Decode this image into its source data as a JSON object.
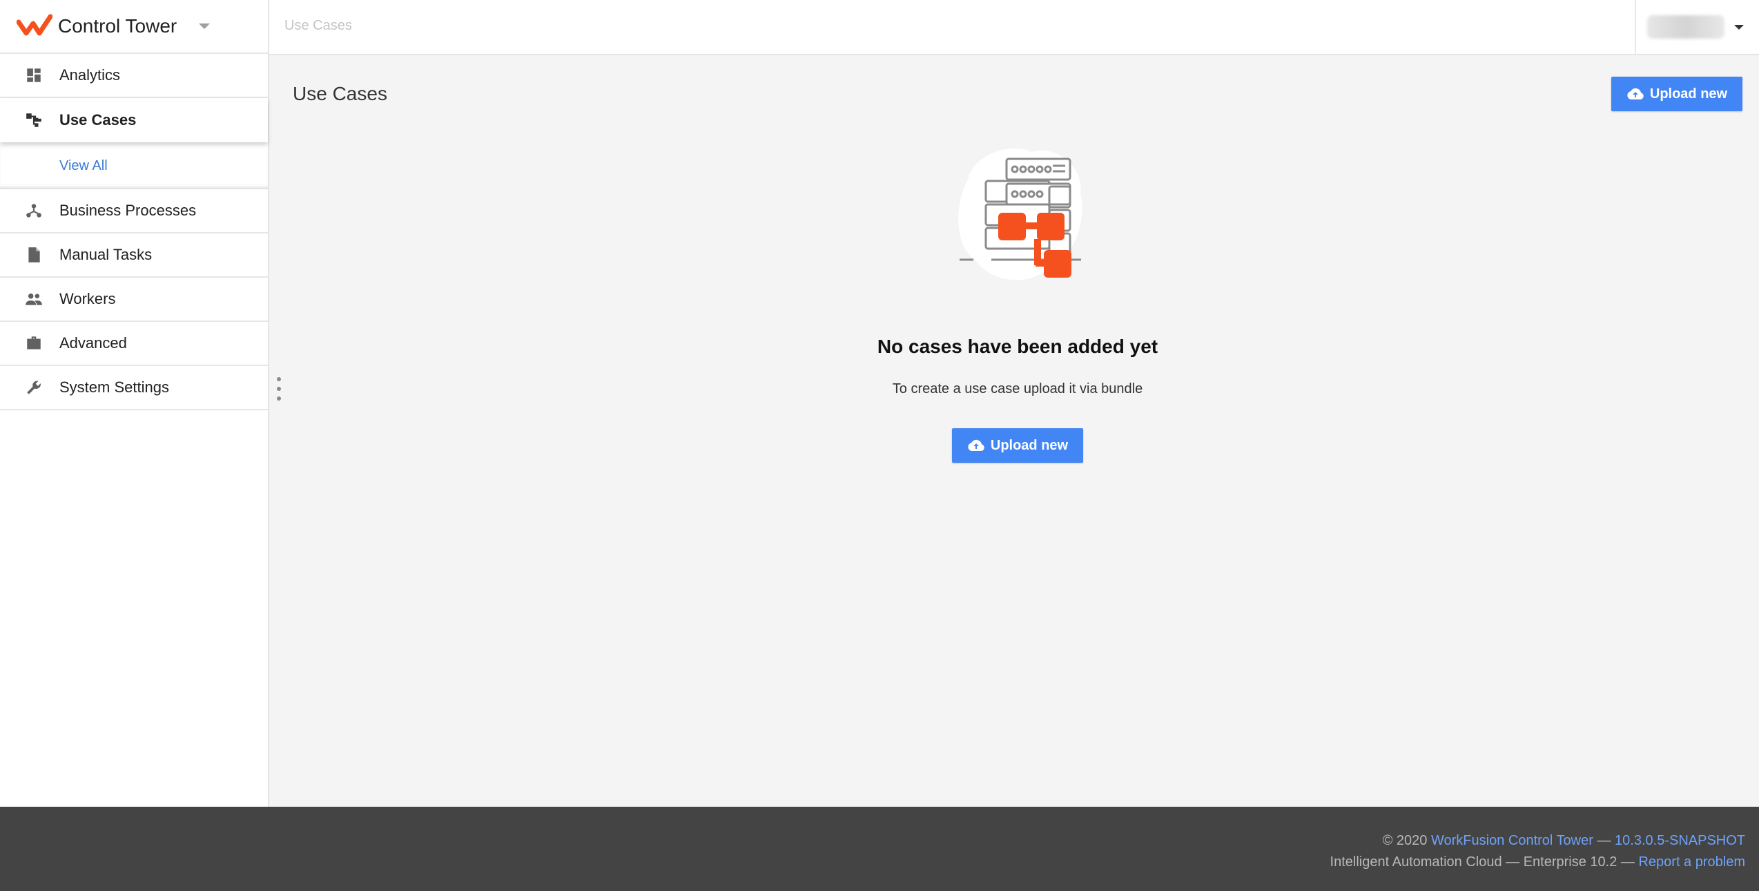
{
  "app": {
    "title": "Control Tower",
    "logo_icon": "workfusion-logo-icon",
    "brand_color": "#f4511e"
  },
  "sidebar": {
    "items": [
      {
        "label": "Analytics",
        "icon": "dashboard-icon"
      },
      {
        "label": "Use Cases",
        "icon": "use-cases-icon",
        "active": true
      },
      {
        "label": "Business Processes",
        "icon": "process-tree-icon"
      },
      {
        "label": "Manual Tasks",
        "icon": "document-icon"
      },
      {
        "label": "Workers",
        "icon": "people-icon"
      },
      {
        "label": "Advanced",
        "icon": "briefcase-icon"
      },
      {
        "label": "System Settings",
        "icon": "wrench-icon"
      }
    ],
    "subnav": {
      "view_all": "View All"
    }
  },
  "header": {
    "breadcrumb": "Use Cases"
  },
  "main": {
    "title": "Use Cases",
    "upload_label": "Upload new",
    "empty_state": {
      "title": "No cases have been added yet",
      "description": "To create a use case upload it via bundle",
      "button_label": "Upload new",
      "illustration": "server-rack-flow-illustration"
    }
  },
  "footer": {
    "copyright": "© 2020",
    "product_link": "WorkFusion Control Tower",
    "separator": " — ",
    "version_link": "10.3.0.5-SNAPSHOT",
    "edition": "Intelligent Automation Cloud — Enterprise 10.2 —",
    "report_link": "Report a problem"
  },
  "colors": {
    "accent": "#4285f4",
    "link": "#3a7bd5",
    "footer_bg": "#444444"
  }
}
